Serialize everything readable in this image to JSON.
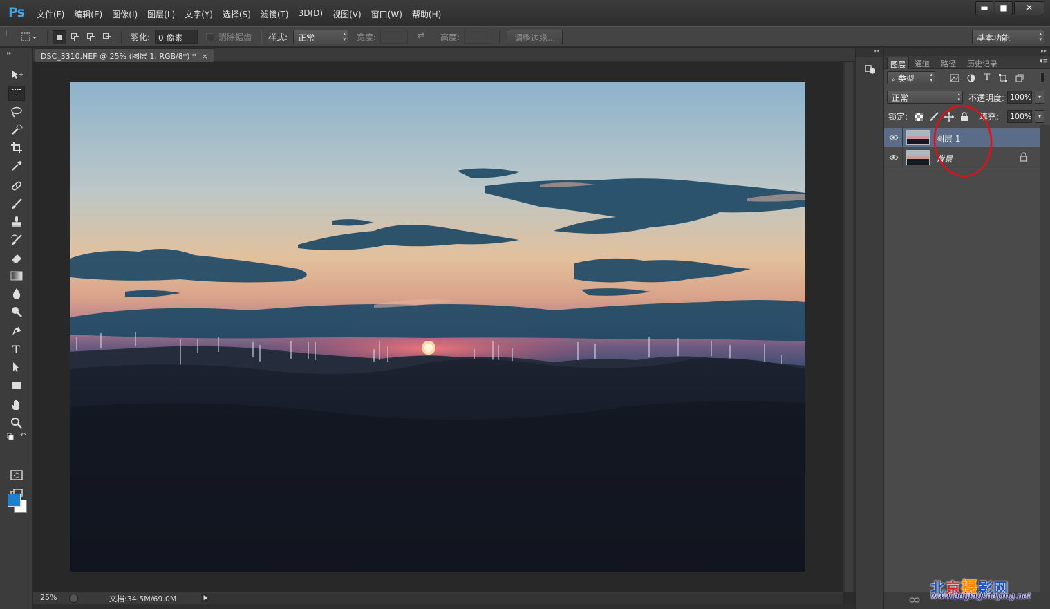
{
  "app": {
    "logo": "Ps",
    "menu": [
      "文件(F)",
      "编辑(E)",
      "图像(I)",
      "图层(L)",
      "文字(Y)",
      "选择(S)",
      "滤镜(T)",
      "3D(D)",
      "视图(V)",
      "窗口(W)",
      "帮助(H)"
    ],
    "window_controls": {
      "minimize": "▬",
      "maximize": "■",
      "close": "✕"
    }
  },
  "options_bar": {
    "feather_label": "羽化:",
    "feather_value": "0 像素",
    "antialias_label": "消除锯齿",
    "style_label": "样式:",
    "style_value": "正常",
    "width_label": "宽度:",
    "height_label": "高度:",
    "refine_edge_button": "调整边缘...",
    "workspace_value": "基本功能"
  },
  "document": {
    "tab_title": "DSC_3310.NEF @ 25% (图层 1, RGB/8*) *",
    "tab_close": "×",
    "zoom": "25%",
    "doc_info": "文档:34.5M/69.0M",
    "status_arrow": "▶"
  },
  "layers_panel": {
    "tabs": [
      "图层",
      "通道",
      "路径",
      "历史记录"
    ],
    "active_tab_index": 0,
    "filter_kind": "类型",
    "blend_mode": "正常",
    "opacity_label": "不透明度:",
    "opacity_value": "100%",
    "lock_label": "锁定:",
    "fill_label": "填充:",
    "fill_value": "100%",
    "layers": [
      {
        "name": "图层 1",
        "visible": true,
        "selected": true,
        "locked": false
      },
      {
        "name": "背景",
        "visible": true,
        "selected": false,
        "locked": true
      }
    ],
    "annotation_color": "#e0101a"
  },
  "watermark": {
    "chars": [
      "北",
      "京",
      "摄",
      "影",
      "网"
    ],
    "url": "www.beijingsheying.net"
  },
  "colors": {
    "foreground": "#1c7fd1",
    "background": "#ffffff",
    "accent": "#4a9fdc",
    "selected_layer": "#5b6c88"
  }
}
